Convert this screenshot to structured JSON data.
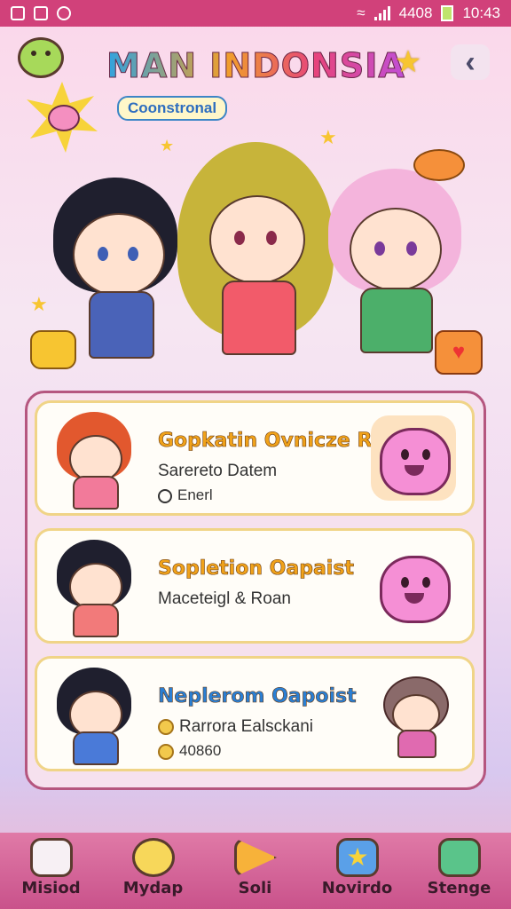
{
  "status_bar": {
    "carrier_text": "4408",
    "time": "10:43"
  },
  "header": {
    "title": "MAN INDONSIA",
    "subtitle": "Coonstronal"
  },
  "cards": [
    {
      "title": "Gopkatin Ovnicze Reiam",
      "line1": "Sarereto Datem",
      "line2": "Enerl",
      "title_color": "#f0a21a"
    },
    {
      "title": "Sopletion Oapaist",
      "line1": "Maceteigl & Roan",
      "line2": "",
      "title_color": "#f0a21a"
    },
    {
      "title": "Neplerom Oapoist",
      "line1": "Rarrora Ealsckani",
      "line2": "40860",
      "title_color": "#2a7fd4"
    }
  ],
  "nav": [
    {
      "label": "Misiod",
      "icon": "robot-icon",
      "color": "#f7f0f4"
    },
    {
      "label": "Mydap",
      "icon": "bear-icon",
      "color": "#f7d75a"
    },
    {
      "label": "Soli",
      "icon": "play-icon",
      "color": "#f7b23a"
    },
    {
      "label": "Novirdo",
      "icon": "star-box-icon",
      "color": "#5aa0e8"
    },
    {
      "label": "Stenge",
      "icon": "gift-icon",
      "color": "#5ac48a"
    }
  ]
}
